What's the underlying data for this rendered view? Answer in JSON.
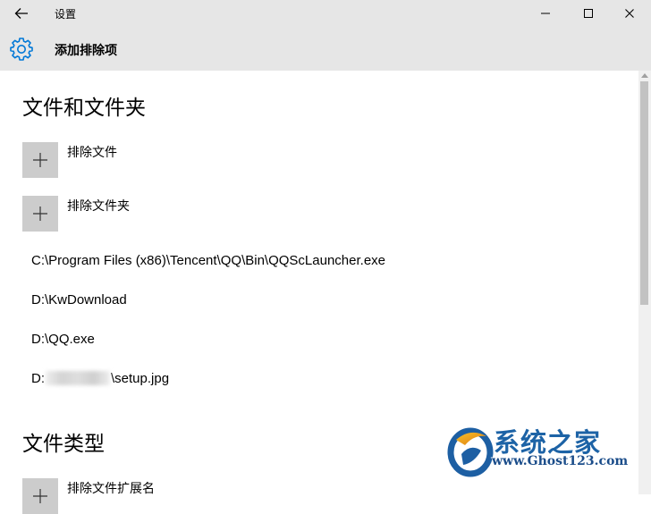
{
  "window": {
    "title": "设置"
  },
  "header": {
    "title": "添加排除项"
  },
  "sections": {
    "files_folders": {
      "title": "文件和文件夹",
      "add_file_label": "排除文件",
      "add_folder_label": "排除文件夹",
      "paths": [
        "C:\\Program Files (x86)\\Tencent\\QQ\\Bin\\QQScLauncher.exe",
        "D:\\KwDownload",
        "D:\\QQ.exe"
      ],
      "blurred_path": {
        "prefix": "D:",
        "suffix": "\\setup.jpg"
      }
    },
    "file_types": {
      "title": "文件类型",
      "add_extension_label": "排除文件扩展名"
    }
  },
  "watermark": {
    "name": "系统之家",
    "url": "www.Ghost123.com"
  },
  "colors": {
    "titlebar_bg": "#e6e6e6",
    "accent": "#0078d7",
    "plus_box": "#cccccc",
    "scrollbar_thumb": "#c2c2c2"
  }
}
